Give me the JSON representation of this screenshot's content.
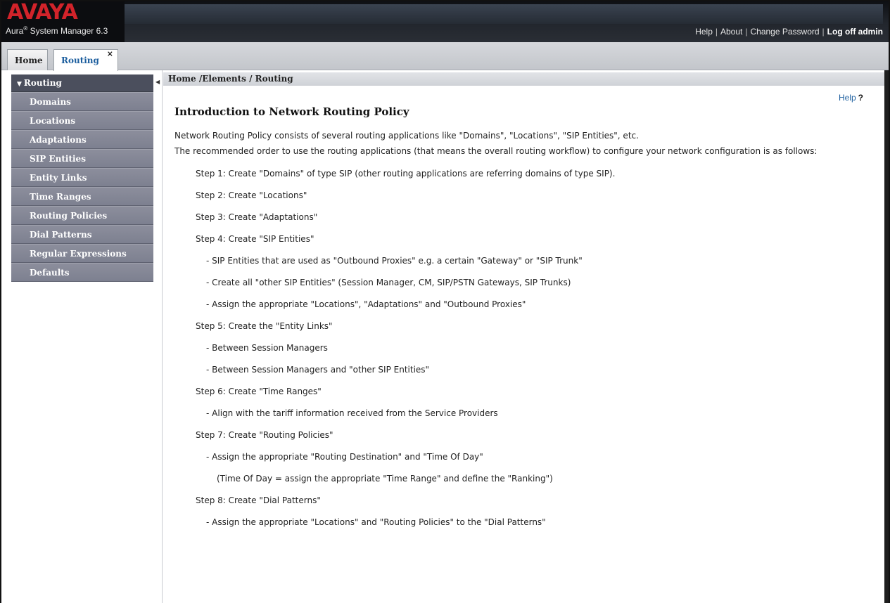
{
  "header": {
    "logo": "AVAYA",
    "product_prefix": "Aura",
    "product_reg": "®",
    "product_suffix": " System Manager 6.3",
    "links": {
      "help": "Help",
      "about": "About",
      "change_password": "Change Password",
      "log_off": "Log off admin"
    }
  },
  "tabs": {
    "home": "Home",
    "routing": "Routing",
    "close_glyph": "×"
  },
  "sidebar": {
    "header": "Routing",
    "items": [
      {
        "label": "Domains"
      },
      {
        "label": "Locations"
      },
      {
        "label": "Adaptations"
      },
      {
        "label": "SIP Entities"
      },
      {
        "label": "Entity Links"
      },
      {
        "label": "Time Ranges"
      },
      {
        "label": "Routing Policies"
      },
      {
        "label": "Dial Patterns"
      },
      {
        "label": "Regular Expressions"
      },
      {
        "label": "Defaults"
      }
    ]
  },
  "breadcrumb": "Home /Elements / Routing",
  "help": {
    "label": "Help",
    "glyph": "?"
  },
  "main": {
    "title": "Introduction to Network Routing Policy",
    "intro1": "Network Routing Policy consists of several routing applications like \"Domains\", \"Locations\", \"SIP Entities\", etc.",
    "intro2": "The recommended order to use the routing applications (that means the overall routing workflow) to configure your network configuration is as follows:",
    "lines": [
      {
        "kind": "step",
        "text": "Step 1: Create \"Domains\" of type SIP (other routing applications are referring domains of type SIP)."
      },
      {
        "kind": "step",
        "text": "Step 2: Create \"Locations\""
      },
      {
        "kind": "step",
        "text": "Step 3: Create \"Adaptations\""
      },
      {
        "kind": "step",
        "text": "Step 4: Create \"SIP Entities\""
      },
      {
        "kind": "sub",
        "text": "- SIP Entities that are used as \"Outbound Proxies\" e.g. a certain \"Gateway\" or \"SIP Trunk\""
      },
      {
        "kind": "sub",
        "text": "- Create all \"other SIP Entities\" (Session Manager, CM, SIP/PSTN Gateways, SIP Trunks)"
      },
      {
        "kind": "sub",
        "text": "- Assign the appropriate \"Locations\", \"Adaptations\" and \"Outbound Proxies\""
      },
      {
        "kind": "step",
        "text": "Step 5: Create the \"Entity Links\""
      },
      {
        "kind": "sub",
        "text": "- Between Session Managers"
      },
      {
        "kind": "sub",
        "text": "- Between Session Managers and \"other SIP Entities\""
      },
      {
        "kind": "step",
        "text": "Step 6: Create \"Time Ranges\""
      },
      {
        "kind": "sub",
        "text": "- Align with the tariff information received from the Service Providers"
      },
      {
        "kind": "step",
        "text": "Step 7: Create \"Routing Policies\""
      },
      {
        "kind": "sub",
        "text": "- Assign the appropriate \"Routing Destination\" and \"Time Of Day\""
      },
      {
        "kind": "subb",
        "text": "(Time Of Day = assign the appropriate \"Time Range\" and define the \"Ranking\")"
      },
      {
        "kind": "step",
        "text": "Step 8: Create \"Dial Patterns\""
      },
      {
        "kind": "sub",
        "text": "- Assign the appropriate \"Locations\" and \"Routing Policies\" to the \"Dial Patterns\""
      }
    ]
  }
}
